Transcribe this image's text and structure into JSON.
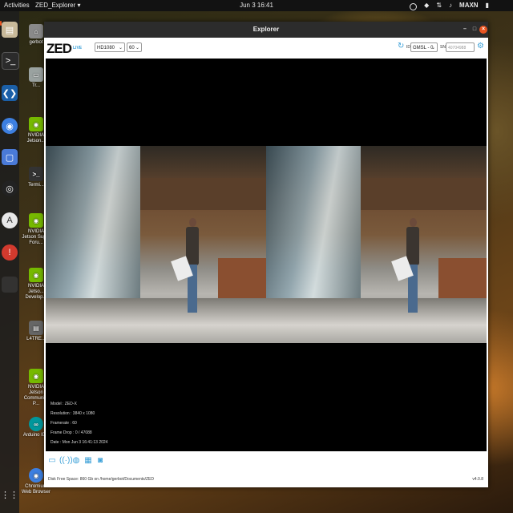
{
  "topbar": {
    "activities": "Activities",
    "app_menu": "ZED_Explorer ▾",
    "clock": "Jun 3  16:41",
    "power_mode": "MAXN",
    "tray_icons": [
      "power-icon",
      "nvidia-icon",
      "network-icon",
      "volume-icon",
      "battery-icon"
    ]
  },
  "dock": {
    "items": [
      "files",
      "terminal",
      "vscode",
      "chromium",
      "screenshot",
      "obs",
      "app-store",
      "update",
      "apps-grid"
    ]
  },
  "desktop": {
    "icons": [
      {
        "label": "gerbot",
        "icon": "home-icon"
      },
      {
        "label": "Tr...",
        "icon": "trash-icon"
      },
      {
        "label": "NVIDIA Jetson...",
        "icon": "nvidia-icon"
      },
      {
        "label": "Termi...",
        "icon": "terminal-icon"
      },
      {
        "label": "NVIDIA Jetson Sup... Foru...",
        "icon": "nvidia-icon"
      },
      {
        "label": "NVIDIA Jetso... Develop...",
        "icon": "nvidia-icon"
      },
      {
        "label": "L4TRE...",
        "icon": "doc-icon"
      },
      {
        "label": "NVIDIA Jetson Community P...",
        "icon": "nvidia-icon"
      },
      {
        "label": "Arduino IDE",
        "icon": "arduino-icon"
      },
      {
        "label": "Chromium Web Browser",
        "icon": "chromium-icon"
      }
    ]
  },
  "window": {
    "title": "Explorer",
    "minimize": "–",
    "maximize": "□",
    "close": "×"
  },
  "toolbar": {
    "logo": "ZED",
    "live": "LIVE",
    "resolution": "HD1080",
    "fps": "60",
    "id_label": "ID",
    "camera_id": "GMSL - 0",
    "sn_label": "SN",
    "sn_placeholder": "40704988"
  },
  "info": {
    "model": "Model : ZED-X",
    "resolution": "Resolution : 3840 x 1080",
    "framerate": "Framerate : 60",
    "frame_drop": "Frame Drop : 0 / 47088",
    "date": "Date : Mon Jun 3 16:41:13 2024"
  },
  "footer": {
    "disk": "Disk Free Space: 860 Gb  on /home/gerbot/Documents/ZED",
    "version": "v4.0.8"
  },
  "colors": {
    "accent": "#3aa0d8",
    "close": "#e95420",
    "titlebar": "#2c2c2c"
  }
}
